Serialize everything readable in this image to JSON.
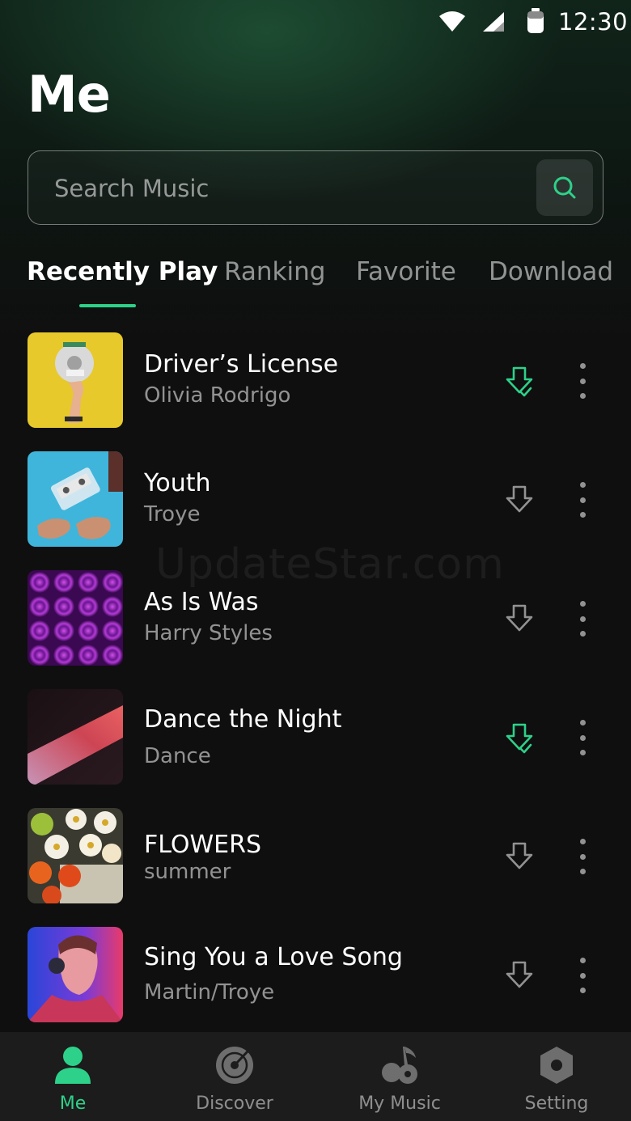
{
  "colors": {
    "accent": "#2ed18a",
    "background": "#0f0f0f",
    "nav_background": "#1c1c1c"
  },
  "status_bar": {
    "time": "12:30"
  },
  "page": {
    "title": "Me"
  },
  "search": {
    "placeholder": "Search Music"
  },
  "tabs": [
    {
      "label": "Recently Play",
      "active": true
    },
    {
      "label": "Ranking",
      "active": false
    },
    {
      "label": "Favorite",
      "active": false
    },
    {
      "label": "Download",
      "active": false
    }
  ],
  "songs": [
    {
      "title": "Driver’s License",
      "artist": "Olivia Rodrigo",
      "downloaded": true
    },
    {
      "title": "Youth",
      "artist": "Troye",
      "downloaded": false
    },
    {
      "title": "As Is Was",
      "artist": "Harry Styles",
      "downloaded": false
    },
    {
      "title": "Dance the Night",
      "artist": "Dance",
      "downloaded": true
    },
    {
      "title": "FLOWERS",
      "artist": "summer",
      "downloaded": false
    },
    {
      "title": "Sing You a Love Song",
      "artist": "Martin/Troye",
      "downloaded": false
    }
  ],
  "watermark": "UpdateStar.com",
  "bottom_nav": [
    {
      "label": "Me",
      "icon": "person-icon",
      "active": true
    },
    {
      "label": "Discover",
      "icon": "disc-icon",
      "active": false
    },
    {
      "label": "My Music",
      "icon": "music-note-icon",
      "active": false
    },
    {
      "label": "Setting",
      "icon": "hexagon-gear-icon",
      "active": false
    }
  ]
}
